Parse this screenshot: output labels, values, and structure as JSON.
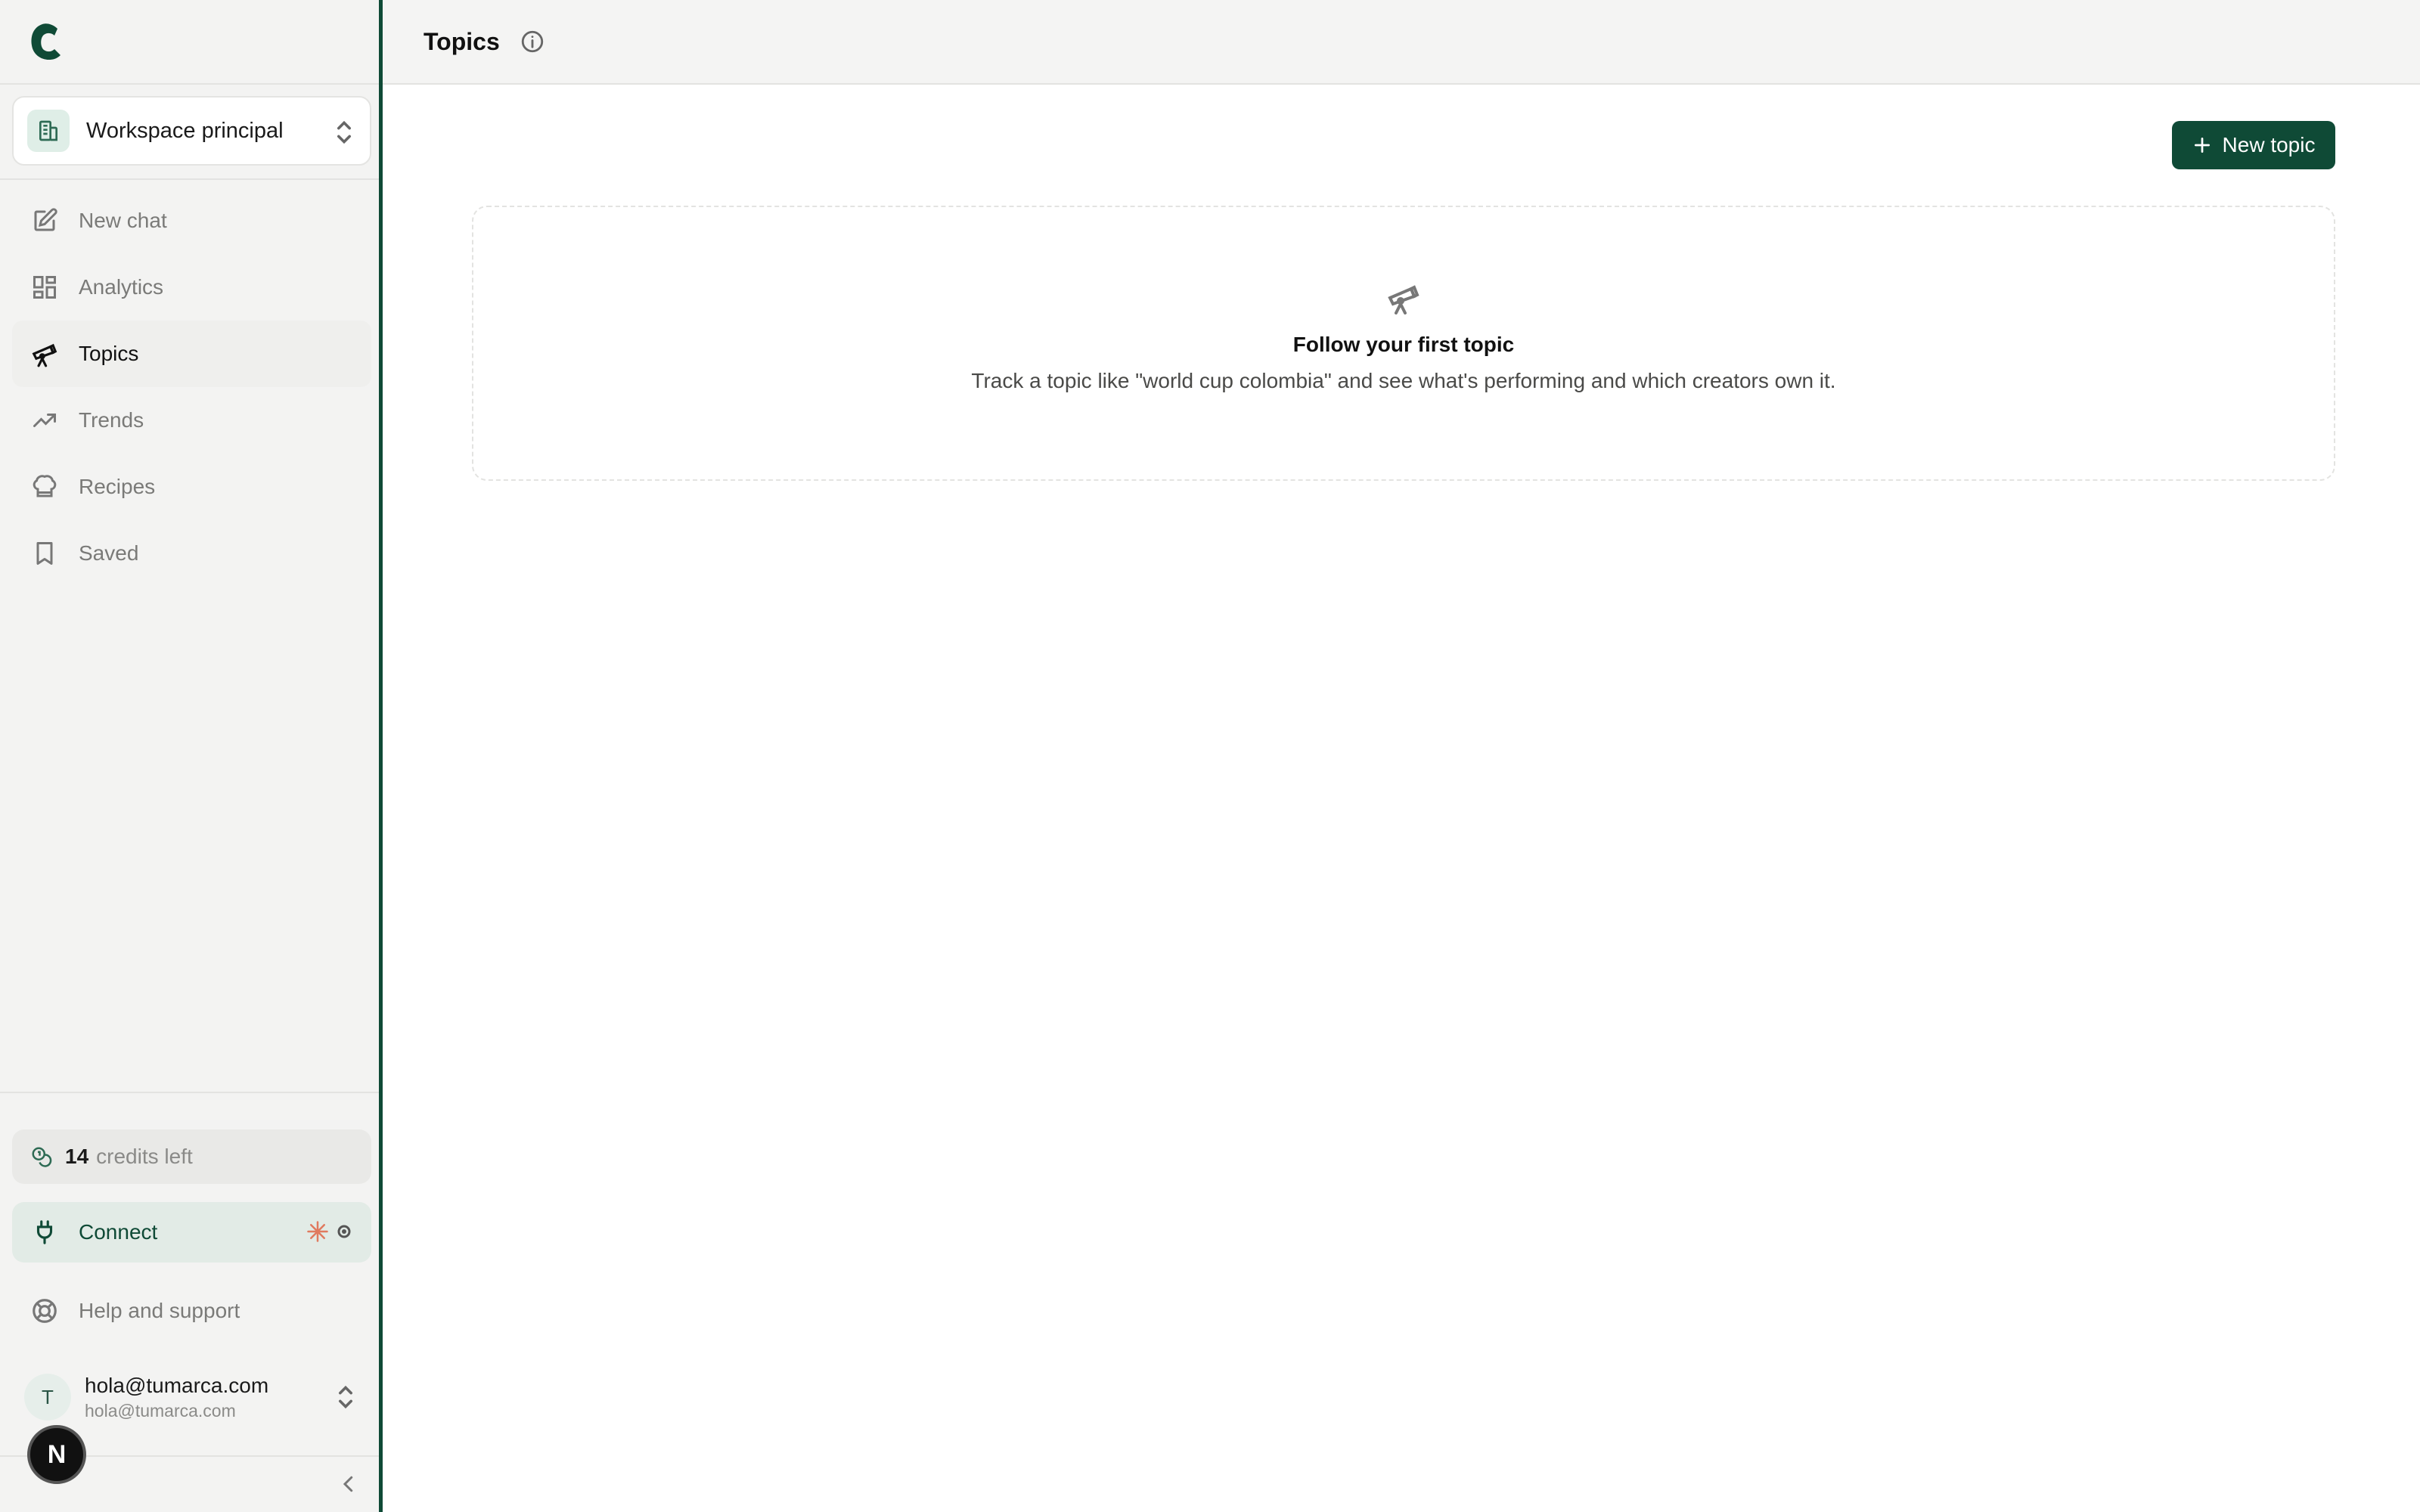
{
  "brand": {
    "logo_letter": "C",
    "accent": "#0f4a36"
  },
  "workspace": {
    "name": "Workspace principal",
    "icon": "building-icon"
  },
  "nav": {
    "items": [
      {
        "label": "New chat",
        "icon": "edit-icon"
      },
      {
        "label": "Analytics",
        "icon": "grid-icon"
      },
      {
        "label": "Topics",
        "icon": "telescope-icon",
        "active": true
      },
      {
        "label": "Trends",
        "icon": "trend-up-icon"
      },
      {
        "label": "Recipes",
        "icon": "chef-hat-icon"
      },
      {
        "label": "Saved",
        "icon": "bookmark-icon"
      }
    ]
  },
  "credits": {
    "count": "14",
    "label": "credits left"
  },
  "connect": {
    "label": "Connect"
  },
  "help": {
    "label": "Help and support"
  },
  "user": {
    "avatar_letter": "T",
    "email": "hola@tumarca.com",
    "sub": "hola@tumarca.com"
  },
  "devtools": {
    "letter": "N"
  },
  "header": {
    "title": "Topics"
  },
  "actions": {
    "new_topic": "New topic"
  },
  "empty_state": {
    "title": "Follow your first topic",
    "description": "Track a topic like \"world cup colombia\" and see what's performing and which creators own it."
  }
}
